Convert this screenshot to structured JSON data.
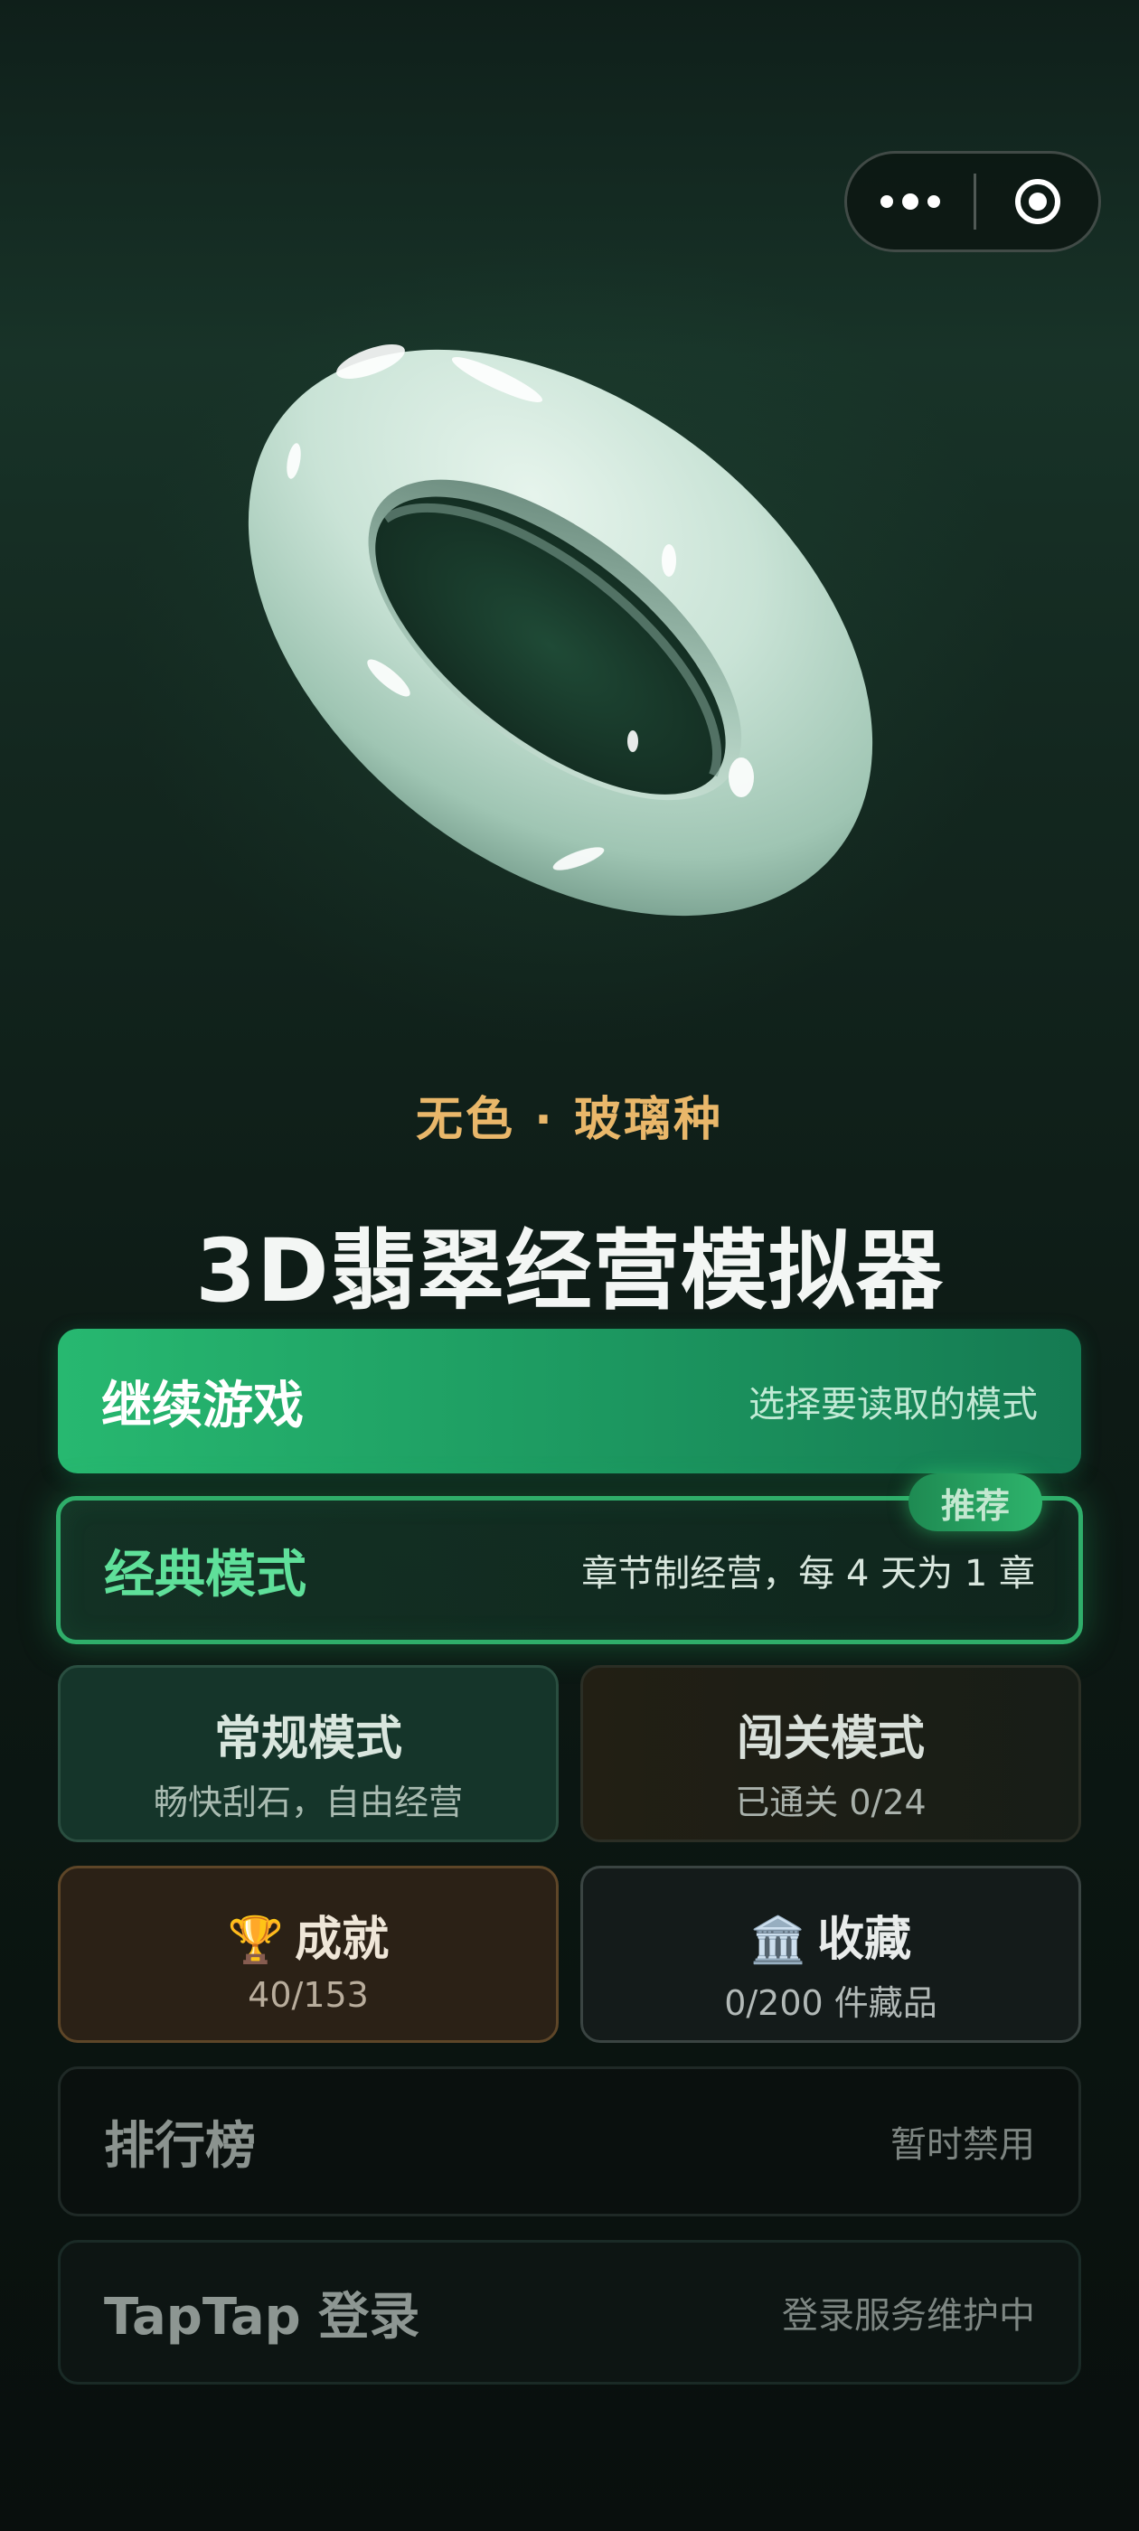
{
  "jade": {
    "name": "无色 · 玻璃种",
    "colors": {
      "body": "#cfe8dc",
      "highlight": "#ffffff",
      "shadow": "#7fa595"
    }
  },
  "title": "3D翡翠经营模拟器",
  "capsule": {
    "more_icon": "more-dots-icon",
    "close_icon": "target-circle-icon"
  },
  "continue": {
    "label": "继续游戏",
    "desc": "选择要读取的模式"
  },
  "classic": {
    "label": "经典模式",
    "desc": "章节制经营，每 4 天为 1 章",
    "badge": "推荐"
  },
  "normal": {
    "label": "常规模式",
    "desc": "畅快刮石，自由经营"
  },
  "levels": {
    "label": "闯关模式",
    "desc": "已通关 0/24"
  },
  "achievements": {
    "icon": "trophy-icon",
    "emoji": "🏆",
    "label": "成就",
    "value": "40/153"
  },
  "collection": {
    "icon": "museum-icon",
    "emoji": "🏛️",
    "label": "收藏",
    "value": "0/200 件藏品"
  },
  "leaderboard": {
    "label": "排行榜",
    "desc": "暂时禁用"
  },
  "taptap": {
    "label": "TapTap 登录",
    "desc": "登录服务维护中"
  },
  "colors": {
    "accent": "#27b870",
    "gold": "#e9b76a",
    "classic_label": "#5fe09a"
  }
}
